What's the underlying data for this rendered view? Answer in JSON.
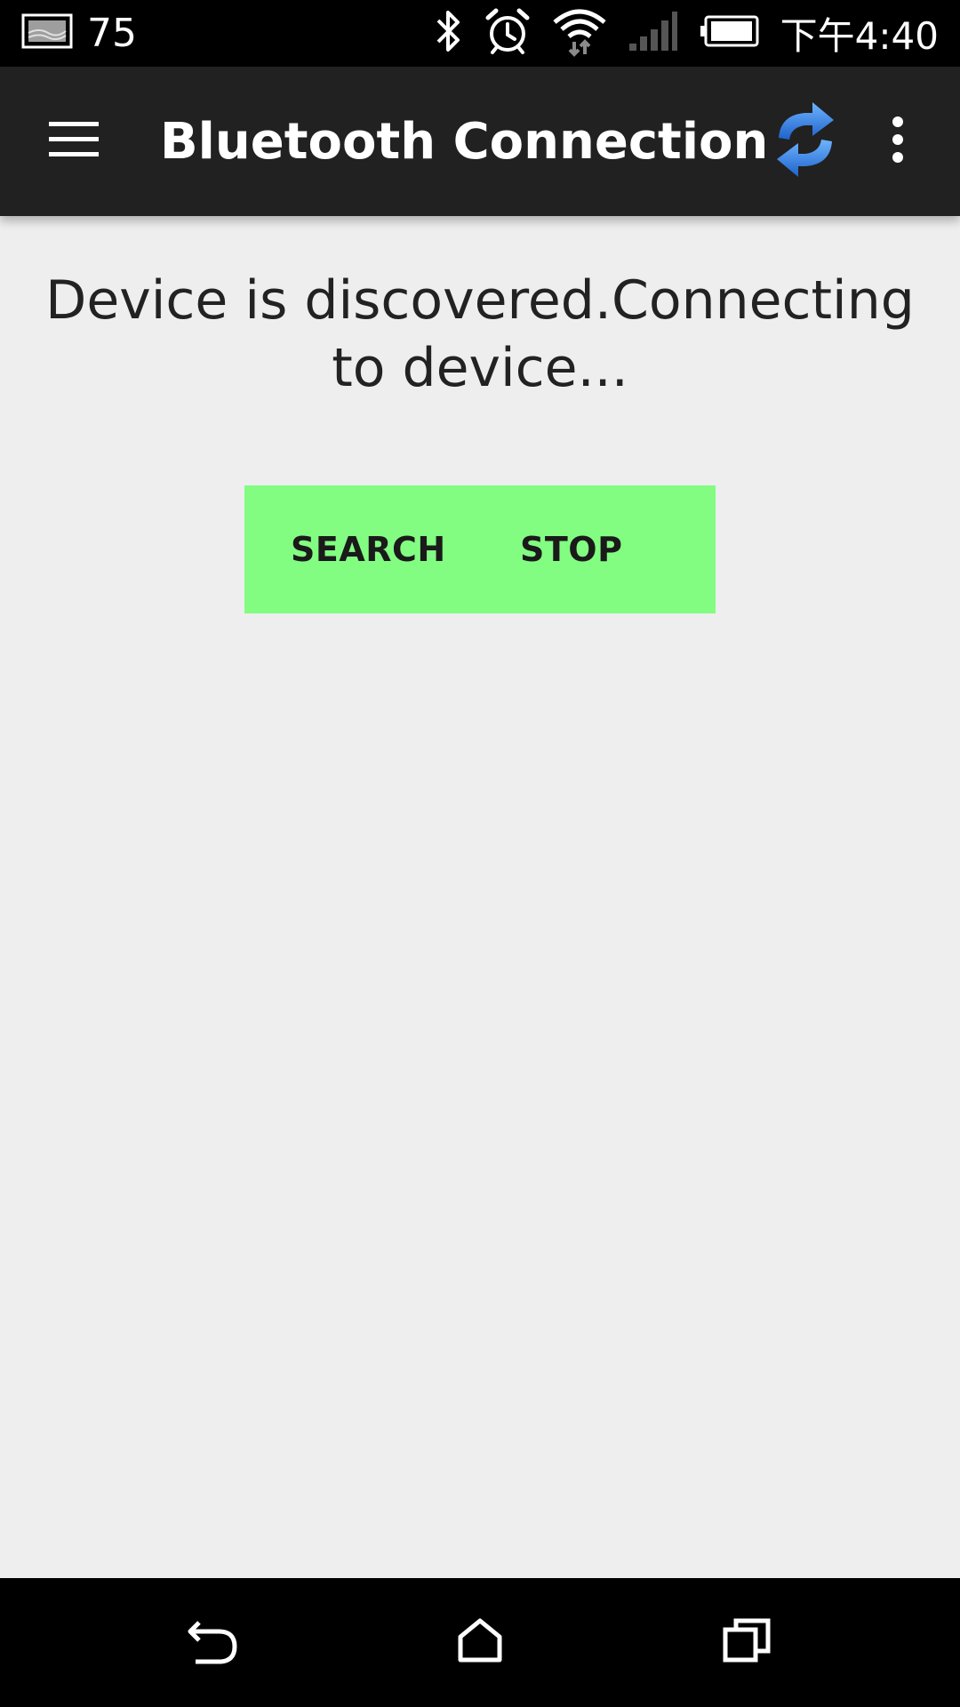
{
  "status_bar": {
    "notification_count": "75",
    "time": "下午4:40",
    "icons": [
      "image-notification-icon",
      "bluetooth-icon",
      "alarm-icon",
      "wifi-icon",
      "signal-icon",
      "battery-icon"
    ]
  },
  "app_bar": {
    "title": "Bluetooth Connection",
    "icons": [
      "menu-icon",
      "refresh-icon",
      "overflow-menu-icon"
    ]
  },
  "main": {
    "message": "Device is discovered.Connecting to device...",
    "buttons": {
      "search_label": "SEARCH",
      "stop_label": "STOP"
    },
    "button_background": "#82fd82"
  },
  "nav_bar": {
    "icons": [
      "back-icon",
      "home-icon",
      "recents-icon"
    ]
  },
  "colors": {
    "status_bar": "#000000",
    "app_bar": "#212121",
    "background": "#eeeeee",
    "refresh_icon": "#2f7de1"
  }
}
